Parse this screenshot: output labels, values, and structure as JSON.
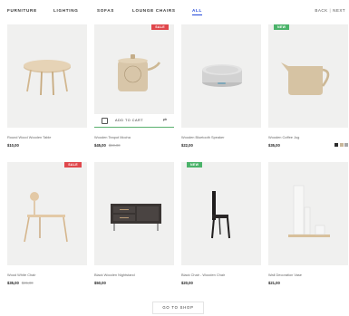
{
  "nav": {
    "tabs": [
      "FURNITURE",
      "LIGHTING",
      "SOFAS",
      "LOUNGE CHAIRS",
      "ALL"
    ],
    "active_tab": "ALL",
    "prev_label": "BACK",
    "next_label": "NEXT"
  },
  "products": [
    {
      "name": "Round Wood Wooden Table",
      "price": "$10,00",
      "old_price": "",
      "badge": "",
      "image": "round-table"
    },
    {
      "name": "Wooden Teapot Mocha",
      "price": "$45,00",
      "old_price": "$60,00",
      "badge": "SALE",
      "image": "teapot",
      "cart_label": "ADD TO CART"
    },
    {
      "name": "Wooden Bluetooth Speaker",
      "price": "$22,00",
      "old_price": "",
      "badge": "",
      "image": "speaker"
    },
    {
      "name": "Wooden Coffee Jug",
      "price": "$35,00",
      "old_price": "",
      "badge": "NEW",
      "image": "jug",
      "swatches": [
        "#2b2b2b",
        "#c9b79a",
        "#a8a8a8"
      ]
    },
    {
      "name": "Wood White Chair",
      "price": "$35,00",
      "old_price": "$45,00",
      "badge": "SALE",
      "image": "round-chair"
    },
    {
      "name": "Black Wooden Nightstand",
      "price": "$50,00",
      "old_price": "",
      "badge": "",
      "image": "sideboard"
    },
    {
      "name": "Black Chair - Wooden Chair",
      "price": "$20,00",
      "old_price": "",
      "badge": "NEW",
      "image": "black-chair"
    },
    {
      "name": "Wall Decoration Vase",
      "price": "$21,00",
      "old_price": "",
      "badge": "",
      "image": "vase-shelf"
    }
  ],
  "go_to_shop": "GO TO SHOP",
  "colors": {
    "accent": "#1f46d9",
    "sale": "#e0474c",
    "new": "#4bb36a"
  }
}
